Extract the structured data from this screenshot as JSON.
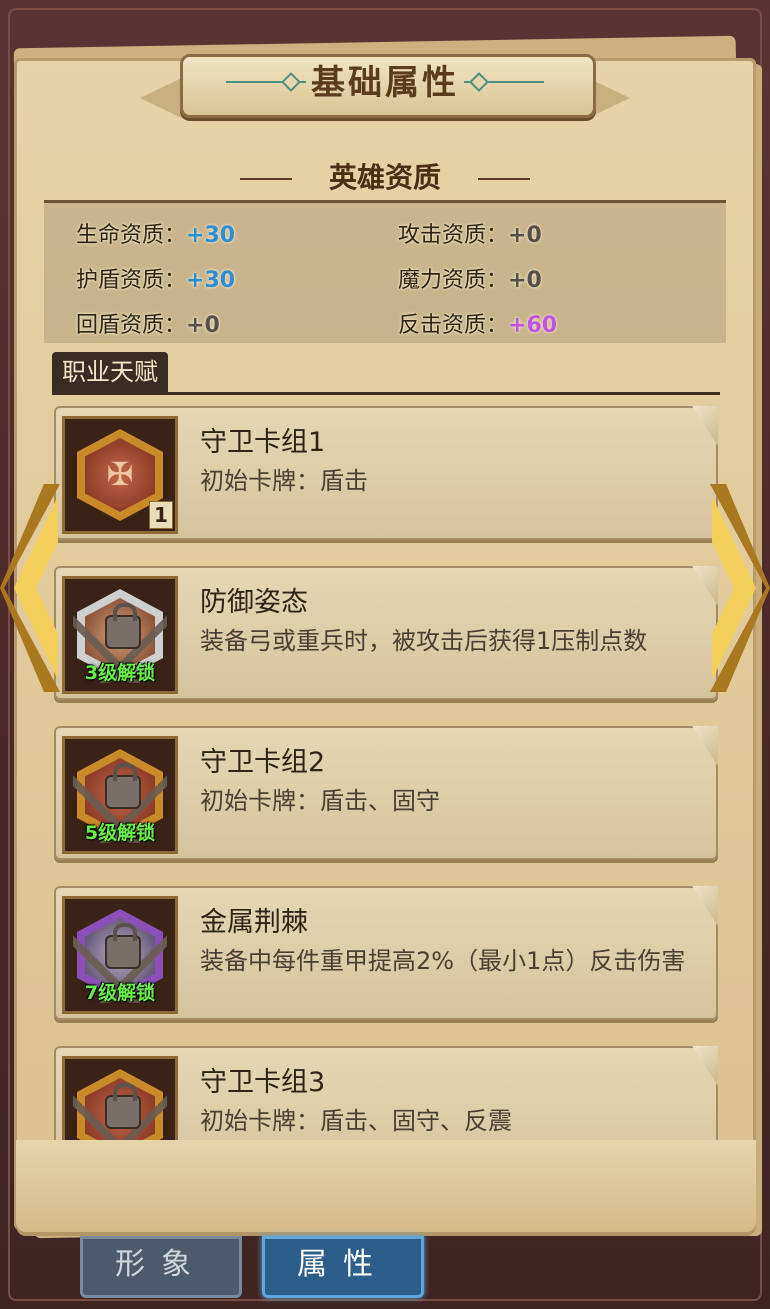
{
  "title": "基础属性",
  "aptitude": {
    "heading": "英雄资质",
    "stats": [
      {
        "label": "生命资质：",
        "value": "+30",
        "color": "#2e8ed2"
      },
      {
        "label": "攻击资质：",
        "value": "+0",
        "color": "#56504a"
      },
      {
        "label": "护盾资质：",
        "value": "+30",
        "color": "#2e8ed2"
      },
      {
        "label": "魔力资质：",
        "value": "+0",
        "color": "#56504a"
      },
      {
        "label": "回盾资质：",
        "value": "+0",
        "color": "#56504a"
      },
      {
        "label": "反击资质：",
        "value": "+60",
        "color": "#c053e0"
      }
    ]
  },
  "talents": {
    "tab_label": "职业天赋",
    "items": [
      {
        "name": "守卫卡组1",
        "desc": "初始卡牌：盾击",
        "level": "1",
        "unlock": "",
        "icon": "crossed-axes-emblem",
        "hex_color": "#c98a2a"
      },
      {
        "name": "防御姿态",
        "desc": "装备弓或重兵时，被攻击后获得1压制点数",
        "level": "",
        "unlock": "3级解锁",
        "icon": "padlock-chain-icon",
        "hex_color": "#cfcfcf"
      },
      {
        "name": "守卫卡组2",
        "desc": "初始卡牌：盾击、固守",
        "level": "",
        "unlock": "5级解锁",
        "icon": "padlock-chain-icon",
        "hex_color": "#c98a2a"
      },
      {
        "name": "金属荆棘",
        "desc": "装备中每件重甲提高2%（最小1点）反击伤害",
        "level": "",
        "unlock": "7级解锁",
        "icon": "padlock-chain-icon",
        "hex_color": "#8a4fb8"
      },
      {
        "name": "守卫卡组3",
        "desc": "初始卡牌：盾击、固守、反震",
        "level": "",
        "unlock": "",
        "icon": "padlock-chain-icon",
        "hex_color": "#c98a2a"
      }
    ]
  },
  "tabs": [
    {
      "label": "形象",
      "active": false
    },
    {
      "label": "属性",
      "active": true
    }
  ]
}
